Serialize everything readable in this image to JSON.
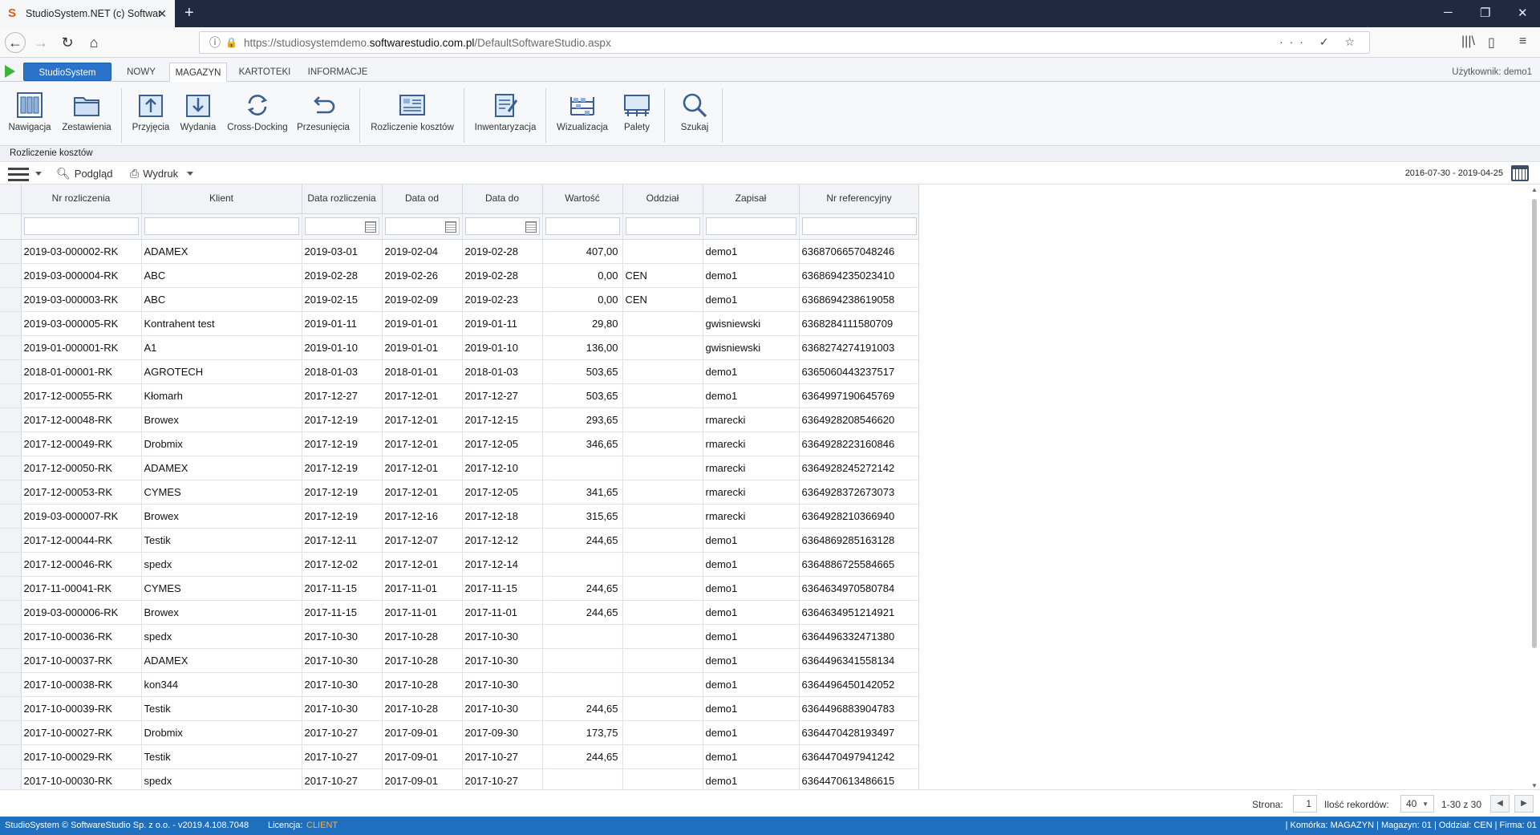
{
  "browser": {
    "tab_title": "StudioSystem.NET (c) SoftwareStudio",
    "url_prefix": "https://studiosystemdemo.",
    "url_domain": "softwarestudio.com.pl",
    "url_path": "/DefaultSoftwareStudio.aspx"
  },
  "ribbon_tabs": [
    {
      "label": "StudioSystem"
    },
    {
      "label": "NOWY"
    },
    {
      "label": "MAGAZYN"
    },
    {
      "label": "KARTOTEKI"
    },
    {
      "label": "INFORMACJE"
    }
  ],
  "user_label": "Użytkownik: demo1",
  "ribbon_buttons": [
    {
      "label": "Nawigacja",
      "icon": "navigation-icon"
    },
    {
      "label": "Zestawienia",
      "icon": "folder-icon"
    },
    {
      "label": "Przyjęcia",
      "icon": "receipt-icon"
    },
    {
      "label": "Wydania",
      "icon": "issue-icon"
    },
    {
      "label": "Cross-Docking",
      "icon": "refresh-icon"
    },
    {
      "label": "Przesunięcia",
      "icon": "undo-icon"
    },
    {
      "label": "Rozliczenie kosztów",
      "icon": "cost-settlement-icon"
    },
    {
      "label": "Inwentaryzacja",
      "icon": "inventory-icon"
    },
    {
      "label": "Wizualizacja",
      "icon": "visualization-icon"
    },
    {
      "label": "Palety",
      "icon": "pallets-icon"
    },
    {
      "label": "Szukaj",
      "icon": "search-icon"
    }
  ],
  "breadcrumb": "Rozliczenie kosztów",
  "toolbar": {
    "preview_label": "Podgląd",
    "print_label": "Wydruk",
    "date_range": "2016-07-30 - 2019-04-25"
  },
  "table": {
    "columns": [
      "Nr rozliczenia",
      "Klient",
      "Data rozliczenia",
      "Data od",
      "Data do",
      "Wartość",
      "Oddział",
      "Zapisał",
      "Nr referencyjny"
    ],
    "rows": [
      [
        "2019-03-000002-RK",
        "ADAMEX",
        "2019-03-01",
        "2019-02-04",
        "2019-02-28",
        "407,00",
        "",
        "demo1",
        "6368706657048246"
      ],
      [
        "2019-03-000004-RK",
        "ABC",
        "2019-02-28",
        "2019-02-26",
        "2019-02-28",
        "0,00",
        "CEN",
        "demo1",
        "6368694235023410"
      ],
      [
        "2019-03-000003-RK",
        "ABC",
        "2019-02-15",
        "2019-02-09",
        "2019-02-23",
        "0,00",
        "CEN",
        "demo1",
        "6368694238619058"
      ],
      [
        "2019-03-000005-RK",
        "Kontrahent test",
        "2019-01-11",
        "2019-01-01",
        "2019-01-11",
        "29,80",
        "",
        "gwisniewski",
        "6368284111580709"
      ],
      [
        "2019-01-000001-RK",
        "A1",
        "2019-01-10",
        "2019-01-01",
        "2019-01-10",
        "136,00",
        "",
        "gwisniewski",
        "6368274274191003"
      ],
      [
        "2018-01-00001-RK",
        "AGROTECH",
        "2018-01-03",
        "2018-01-01",
        "2018-01-03",
        "503,65",
        "",
        "demo1",
        "6365060443237517"
      ],
      [
        "2017-12-00055-RK",
        "Kłomarh",
        "2017-12-27",
        "2017-12-01",
        "2017-12-27",
        "503,65",
        "",
        "demo1",
        "6364997190645769"
      ],
      [
        "2017-12-00048-RK",
        "Browex",
        "2017-12-19",
        "2017-12-01",
        "2017-12-15",
        "293,65",
        "",
        "rmarecki",
        "6364928208546620"
      ],
      [
        "2017-12-00049-RK",
        "Drobmix",
        "2017-12-19",
        "2017-12-01",
        "2017-12-05",
        "346,65",
        "",
        "rmarecki",
        "6364928223160846"
      ],
      [
        "2017-12-00050-RK",
        "ADAMEX",
        "2017-12-19",
        "2017-12-01",
        "2017-12-10",
        "",
        "",
        "rmarecki",
        "6364928245272142"
      ],
      [
        "2017-12-00053-RK",
        "CYMES",
        "2017-12-19",
        "2017-12-01",
        "2017-12-05",
        "341,65",
        "",
        "rmarecki",
        "6364928372673073"
      ],
      [
        "2019-03-000007-RK",
        "Browex",
        "2017-12-19",
        "2017-12-16",
        "2017-12-18",
        "315,65",
        "",
        "rmarecki",
        "6364928210366940"
      ],
      [
        "2017-12-00044-RK",
        "Testik",
        "2017-12-11",
        "2017-12-07",
        "2017-12-12",
        "244,65",
        "",
        "demo1",
        "6364869285163128"
      ],
      [
        "2017-12-00046-RK",
        "spedx",
        "2017-12-02",
        "2017-12-01",
        "2017-12-14",
        "",
        "",
        "demo1",
        "6364886725584665"
      ],
      [
        "2017-11-00041-RK",
        "CYMES",
        "2017-11-15",
        "2017-11-01",
        "2017-11-15",
        "244,65",
        "",
        "demo1",
        "6364634970580784"
      ],
      [
        "2019-03-000006-RK",
        "Browex",
        "2017-11-15",
        "2017-11-01",
        "2017-11-01",
        "244,65",
        "",
        "demo1",
        "6364634951214921"
      ],
      [
        "2017-10-00036-RK",
        "spedx",
        "2017-10-30",
        "2017-10-28",
        "2017-10-30",
        "",
        "",
        "demo1",
        "6364496332471380"
      ],
      [
        "2017-10-00037-RK",
        "ADAMEX",
        "2017-10-30",
        "2017-10-28",
        "2017-10-30",
        "",
        "",
        "demo1",
        "6364496341558134"
      ],
      [
        "2017-10-00038-RK",
        "kon344",
        "2017-10-30",
        "2017-10-28",
        "2017-10-30",
        "",
        "",
        "demo1",
        "6364496450142052"
      ],
      [
        "2017-10-00039-RK",
        "Testik",
        "2017-10-30",
        "2017-10-28",
        "2017-10-30",
        "244,65",
        "",
        "demo1",
        "6364496883904783"
      ],
      [
        "2017-10-00027-RK",
        "Drobmix",
        "2017-10-27",
        "2017-09-01",
        "2017-09-30",
        "173,75",
        "",
        "demo1",
        "6364470428193497"
      ],
      [
        "2017-10-00029-RK",
        "Testik",
        "2017-10-27",
        "2017-09-01",
        "2017-10-27",
        "244,65",
        "",
        "demo1",
        "6364470497941242"
      ],
      [
        "2017-10-00030-RK",
        "spedx",
        "2017-10-27",
        "2017-09-01",
        "2017-10-27",
        "",
        "",
        "demo1",
        "6364470613486615"
      ]
    ]
  },
  "pager": {
    "page_label": "Strona:",
    "page_value": "1",
    "records_label": "Ilość rekordów:",
    "records_value": "40",
    "range_text": "1-30 z 30"
  },
  "status": {
    "copyright": "StudioSystem © SoftwareStudio Sp. z o.o. - v2019.4.108.7048",
    "license_label": "Licencja:",
    "license_value": "CLIENT",
    "right_info": "| Komórka: MAGAZYN | Magazyn: 01 | Oddział: CEN | Firma: 01"
  }
}
